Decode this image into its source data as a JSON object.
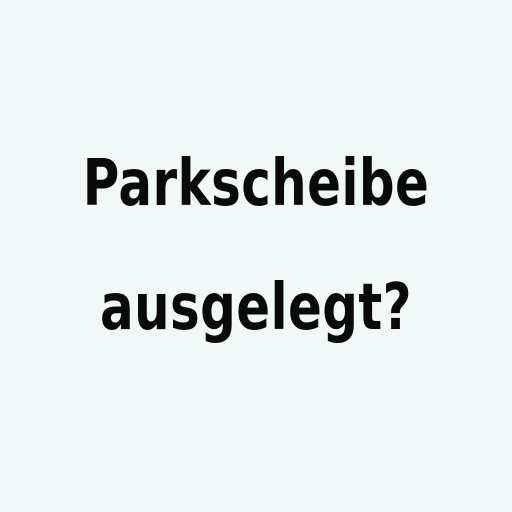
{
  "background_color": "#f1f9f8",
  "text_color": "#0a0a0a",
  "message": {
    "line1": "Parkscheibe",
    "line2": "ausgelegt?"
  }
}
